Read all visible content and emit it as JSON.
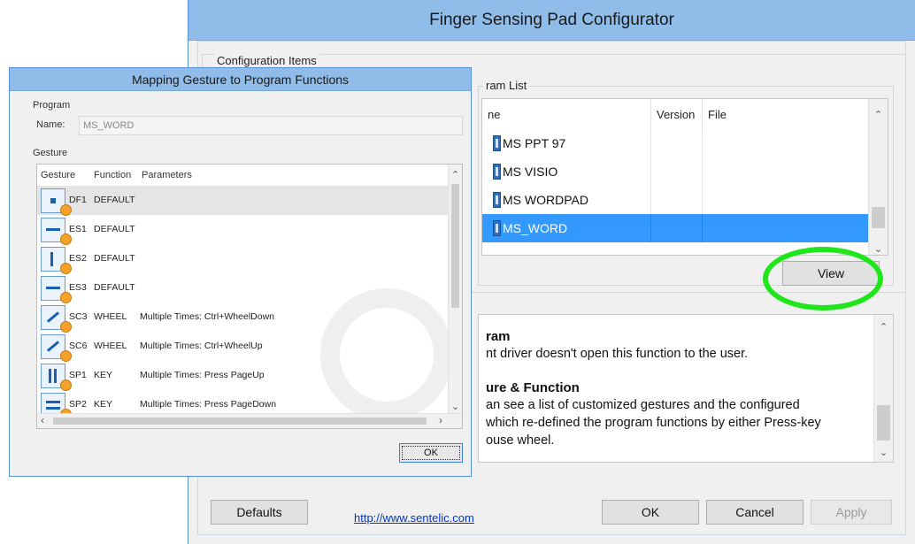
{
  "main_window": {
    "title": "Finger Sensing Pad Configurator",
    "config_items_label": "Configuration Items",
    "program_list_label": "ram List",
    "columns": [
      "ne",
      "Version",
      "File"
    ],
    "programs": [
      {
        "name": "MS PPT 97",
        "version": "",
        "file": "",
        "selected": false
      },
      {
        "name": "MS VISIO",
        "version": "",
        "file": "",
        "selected": false
      },
      {
        "name": "MS WORDPAD",
        "version": "",
        "file": "",
        "selected": false
      },
      {
        "name": "MS_WORD",
        "version": "",
        "file": "",
        "selected": true
      }
    ],
    "view_button": "View",
    "description": {
      "heading1": "ram",
      "line1": "nt driver doesn't open this function to the user.",
      "heading2": "ure & Function",
      "line2": "an see a list of customized gestures and the configured",
      "line3": "which re-defined the program functions by either Press-key",
      "line4": "ouse wheel."
    },
    "buttons": {
      "defaults": "Defaults",
      "ok": "OK",
      "cancel": "Cancel",
      "apply": "Apply"
    },
    "link": "http://www.sentelic.com"
  },
  "gesture_dialog": {
    "title": "Mapping Gesture to Program Functions",
    "program_label": "Program",
    "name_label": "Name:",
    "name_value": "MS_WORD",
    "gesture_label": "Gesture",
    "columns": [
      "Gesture",
      "Function",
      "Parameters"
    ],
    "rows": [
      {
        "code": "DF1",
        "function": "DEFAULT",
        "params": "",
        "selected": true
      },
      {
        "code": "ES1",
        "function": "DEFAULT",
        "params": "",
        "selected": false
      },
      {
        "code": "ES2",
        "function": "DEFAULT",
        "params": "",
        "selected": false
      },
      {
        "code": "ES3",
        "function": "DEFAULT",
        "params": "",
        "selected": false
      },
      {
        "code": "SC3",
        "function": "WHEEL",
        "params": "Multiple Times: Ctrl+WheelDown",
        "selected": false
      },
      {
        "code": "SC6",
        "function": "WHEEL",
        "params": "Multiple Times: Ctrl+WheelUp",
        "selected": false
      },
      {
        "code": "SP1",
        "function": "KEY",
        "params": "Multiple Times: Press PageUp",
        "selected": false
      },
      {
        "code": "SP2",
        "function": "KEY",
        "params": "Multiple Times: Press PageDown",
        "selected": false
      }
    ],
    "ok_button": "OK"
  },
  "colors": {
    "title_bar": "#8fbce8",
    "selection": "#3399ff",
    "highlight_ring": "#1ee61a"
  }
}
